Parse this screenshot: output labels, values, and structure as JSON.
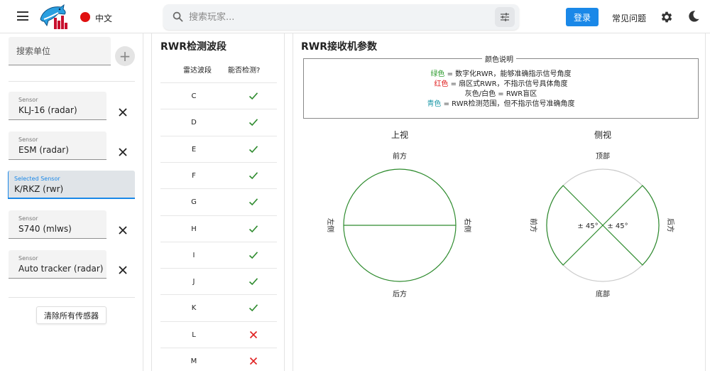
{
  "header": {
    "language": "中文",
    "search_placeholder": "搜索玩家...",
    "login": "登录",
    "faq": "常见问题",
    "icons": [
      "menu-icon",
      "logo-icon",
      "language-flag-icon",
      "search-icon",
      "filter-sliders-icon",
      "gear-icon",
      "moon-icon"
    ],
    "accent_color": "#1a88e8"
  },
  "sidebar": {
    "add_unit_placeholder": "搜索单位",
    "add_symbol": "+",
    "sensors": [
      {
        "label": "Sensor",
        "value": "KLJ-16 (radar)"
      },
      {
        "label": "Sensor",
        "value": "ESM (radar)"
      },
      {
        "label": "Selected Sensor",
        "value": "K/RKZ (rwr)"
      },
      {
        "label": "Sensor",
        "value": "S740 (mlws)"
      },
      {
        "label": "Sensor",
        "value": "Auto tracker (radar)"
      }
    ],
    "clear_all": "清除所有传感器"
  },
  "bands": {
    "title": "RWR检测波段",
    "col_band": "雷达波段",
    "col_detect": "能否检测?",
    "rows": [
      {
        "band": "C",
        "detect": true
      },
      {
        "band": "D",
        "detect": true
      },
      {
        "band": "E",
        "detect": true
      },
      {
        "band": "F",
        "detect": true
      },
      {
        "band": "G",
        "detect": true
      },
      {
        "band": "H",
        "detect": true
      },
      {
        "band": "I",
        "detect": true
      },
      {
        "band": "J",
        "detect": true
      },
      {
        "band": "K",
        "detect": true
      },
      {
        "band": "L",
        "detect": false
      },
      {
        "band": "M",
        "detect": false
      }
    ],
    "colors": {
      "yes": "#2e8b2e",
      "no": "#e02020"
    }
  },
  "rwr": {
    "title": "RWR接收机参数",
    "legend": {
      "title": "颜色说明",
      "green_word": "绿色",
      "green_text": " = 数字化RWR，能够准确指示信号角度",
      "red_word": "红色",
      "red_text": " = 扇区式RWR，不指示信号具体角度",
      "gray_text": "灰色/白色 = RWR盲区",
      "cyan_word": "青色",
      "cyan_text": " = RWR检测范围，但不指示信号准确角度",
      "colors": {
        "green": "#2e9b2e",
        "red": "#e02020",
        "cyan": "#1f9aa8",
        "line": "#2e8b2e",
        "blind": "#cccccc"
      }
    },
    "top_view": {
      "title": "上视",
      "front": "前方",
      "back": "后方",
      "left": "左侧",
      "right": "右侧"
    },
    "side_view": {
      "title": "侧视",
      "top": "顶部",
      "bottom": "底部",
      "front": "前方",
      "back": "后方",
      "angle_left": "± 45°",
      "angle_right": "± 45°"
    }
  }
}
